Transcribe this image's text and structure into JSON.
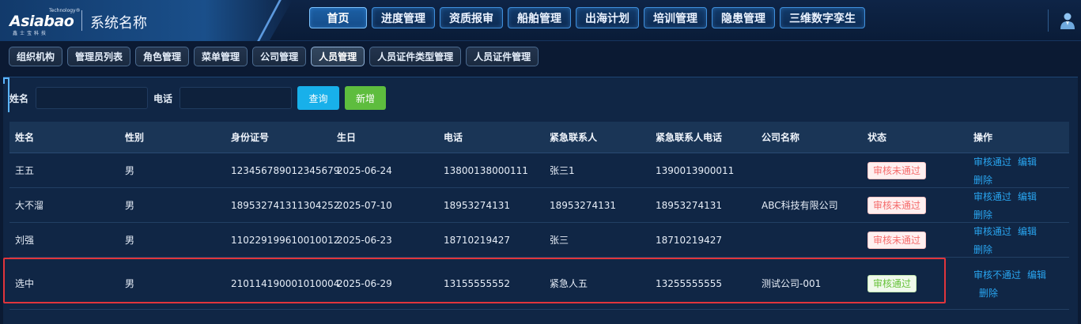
{
  "header": {
    "logo_text": "Asiabao",
    "logo_tm": "Technology®",
    "logo_sub": "鑫士宝科技",
    "system_name": "系统名称",
    "nav": [
      {
        "label": "首页",
        "active": true
      },
      {
        "label": "进度管理",
        "active": false
      },
      {
        "label": "资质报审",
        "active": false
      },
      {
        "label": "船舶管理",
        "active": false
      },
      {
        "label": "出海计划",
        "active": false
      },
      {
        "label": "培训管理",
        "active": false
      },
      {
        "label": "隐患管理",
        "active": false
      },
      {
        "label": "三维数字孪生",
        "active": false
      }
    ],
    "user_icon": "user-icon"
  },
  "subtabs": [
    {
      "label": "组织机构",
      "active": false
    },
    {
      "label": "管理员列表",
      "active": false
    },
    {
      "label": "角色管理",
      "active": false
    },
    {
      "label": "菜单管理",
      "active": false
    },
    {
      "label": "公司管理",
      "active": false
    },
    {
      "label": "人员管理",
      "active": true
    },
    {
      "label": "人员证件类型管理",
      "active": false
    },
    {
      "label": "人员证件管理",
      "active": false
    }
  ],
  "search": {
    "name_label": "姓名",
    "name_value": "",
    "phone_label": "电话",
    "phone_value": "",
    "query_button": "查询",
    "add_button": "新增"
  },
  "table": {
    "columns": [
      "姓名",
      "性别",
      "身份证号",
      "生日",
      "电话",
      "紧急联系人",
      "紧急联系人电话",
      "公司名称",
      "状态",
      "操作"
    ],
    "rows": [
      {
        "name": "王五",
        "gender": "男",
        "id_no": "123456789012345679",
        "birthday": "2025-06-24",
        "phone": "13800138000111",
        "emergency_contact": "张三1",
        "emergency_phone": "1390013900011",
        "company": "",
        "status": "审核未通过",
        "status_type": "reject",
        "actions": [
          "审核通过",
          "编辑",
          "删除"
        ]
      },
      {
        "name": "大不溜",
        "gender": "男",
        "id_no": "189532741311304252",
        "birthday": "2025-07-10",
        "phone": "18953274131",
        "emergency_contact": "18953274131",
        "emergency_phone": "18953274131",
        "company": "ABC科技有限公司",
        "status": "审核未通过",
        "status_type": "reject",
        "actions": [
          "审核通过",
          "编辑",
          "删除"
        ]
      },
      {
        "name": "刘强",
        "gender": "男",
        "id_no": "110229199610010012",
        "birthday": "2025-06-23",
        "phone": "18710219427",
        "emergency_contact": "张三",
        "emergency_phone": "18710219427",
        "company": "",
        "status": "审核未通过",
        "status_type": "reject",
        "actions": [
          "审核通过",
          "编辑",
          "删除"
        ]
      },
      {
        "name": "选中",
        "gender": "男",
        "id_no": "210114190001010004",
        "birthday": "2025-06-29",
        "phone": "13155555552",
        "emergency_contact": "紧急人五",
        "emergency_phone": "13255555555",
        "company": "测试公司-001",
        "status": "审核通过",
        "status_type": "pass",
        "actions": [
          "审核不通过",
          "编辑",
          "删除"
        ],
        "selected": true
      }
    ]
  },
  "colors": {
    "accent": "#18b0ea",
    "add": "#5ebd3e",
    "link": "#29a5f0",
    "selected_border": "#e0353c"
  }
}
